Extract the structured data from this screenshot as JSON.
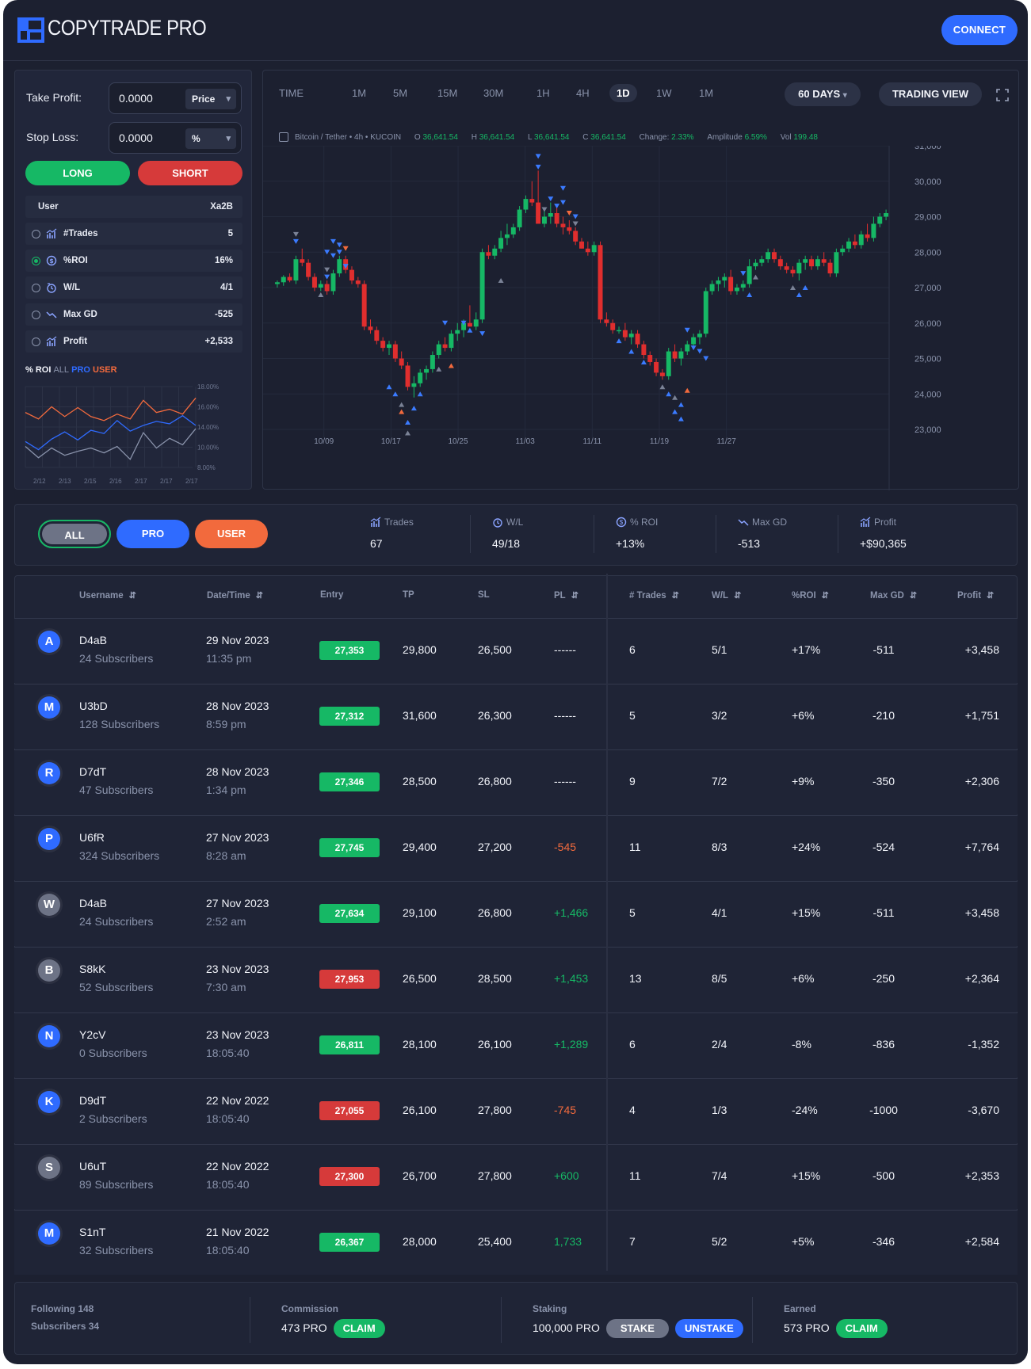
{
  "header": {
    "brand": "COPYTRADE PRO",
    "connect": "CONNECT"
  },
  "order": {
    "tp_label": "Take Profit:",
    "tp_value": "0.0000",
    "tp_unit": "Price",
    "sl_label": "Stop Loss:",
    "sl_value": "0.0000",
    "sl_unit": "%",
    "long": "LONG",
    "short": "SHORT"
  },
  "user_panel": {
    "head_left": "User",
    "head_right": "Xa2B",
    "rows": [
      {
        "name": "#Trades",
        "value": "5",
        "selected": false
      },
      {
        "name": "%ROI",
        "value": "16%",
        "selected": true
      },
      {
        "name": "W/L",
        "value": "4/1",
        "selected": false
      },
      {
        "name": "Max GD",
        "value": "-525",
        "selected": false
      },
      {
        "name": "Profit",
        "value": "+2,533",
        "selected": false
      }
    ]
  },
  "roi_chart": {
    "title_a": "% ROI",
    "title_b": "ALL",
    "title_c": "PRO",
    "title_d": "USER",
    "yticks": [
      "18.00%",
      "16.00%",
      "14.00%",
      "10.00%",
      "8.00%"
    ],
    "xticks": [
      "2/12",
      "2/13",
      "2/15",
      "2/16",
      "2/17",
      "2/17",
      "2/17"
    ]
  },
  "timeframes": [
    "TIME",
    "1M",
    "5M",
    "15M",
    "30M",
    "1H",
    "4H",
    "1D",
    "1W",
    "1M"
  ],
  "timeframe_active": "1D",
  "range": "60 DAYS",
  "trading_view": "TRADING VIEW",
  "legend": {
    "pair": "Bitcoin / Tether • 4h • KUCOIN",
    "o": "O",
    "o_val": "36,641.54",
    "h": "H",
    "h_val": "36,641.54",
    "l": "L",
    "l_val": "36,641.54",
    "c": "C",
    "c_val": "36,641.54",
    "change": "Change:",
    "change_val": "2.33%",
    "amp": "Amplitude",
    "amp_val": "6.59%",
    "vol": "Vol",
    "vol_val": "199.48"
  },
  "chart_data": {
    "type": "candlestick",
    "y_ticks": [
      "31,000",
      "30,000",
      "29,000",
      "28,000",
      "27,000",
      "26,000",
      "25,000",
      "24,000",
      "23,000"
    ],
    "x_ticks": [
      "10/09",
      "10/17",
      "10/25",
      "11/03",
      "11/11",
      "11/19",
      "11/27"
    ],
    "ylim": [
      23000,
      31000
    ],
    "candles": [
      [
        27100,
        27200,
        27000,
        27150
      ],
      [
        27150,
        27350,
        27050,
        27300
      ],
      [
        27300,
        27400,
        27150,
        27200
      ],
      [
        27200,
        27900,
        27100,
        27800
      ],
      [
        27800,
        28100,
        27600,
        27700
      ],
      [
        27700,
        27800,
        27200,
        27300
      ],
      [
        27300,
        27400,
        26900,
        27000
      ],
      [
        27000,
        27200,
        26900,
        27100
      ],
      [
        27100,
        27200,
        26800,
        26900
      ],
      [
        26900,
        27500,
        26800,
        27400
      ],
      [
        27400,
        27900,
        27300,
        27800
      ],
      [
        27800,
        27900,
        27400,
        27500
      ],
      [
        27500,
        27600,
        27100,
        27200
      ],
      [
        27200,
        27300,
        27000,
        27100
      ],
      [
        27100,
        27200,
        25800,
        25900
      ],
      [
        25900,
        26100,
        25700,
        25800
      ],
      [
        25800,
        25900,
        25400,
        25500
      ],
      [
        25500,
        25600,
        25200,
        25300
      ],
      [
        25300,
        25500,
        25100,
        25400
      ],
      [
        25400,
        25500,
        24900,
        25000
      ],
      [
        25000,
        25200,
        24700,
        24800
      ],
      [
        24800,
        24900,
        24100,
        24200
      ],
      [
        24200,
        24500,
        23900,
        24300
      ],
      [
        24300,
        24700,
        24200,
        24600
      ],
      [
        24600,
        24800,
        24400,
        24700
      ],
      [
        24700,
        25200,
        24600,
        25100
      ],
      [
        25100,
        25500,
        25000,
        25400
      ],
      [
        25400,
        25600,
        25200,
        25300
      ],
      [
        25300,
        25800,
        25200,
        25700
      ],
      [
        25700,
        26000,
        25500,
        25800
      ],
      [
        25800,
        26100,
        25600,
        26000
      ],
      [
        26000,
        26500,
        25900,
        25900
      ],
      [
        25900,
        26300,
        25800,
        26100
      ],
      [
        26100,
        28100,
        26000,
        28000
      ],
      [
        28000,
        28200,
        27800,
        27900
      ],
      [
        27900,
        28200,
        27800,
        28100
      ],
      [
        28100,
        28600,
        28000,
        28400
      ],
      [
        28400,
        28800,
        28200,
        28500
      ],
      [
        28500,
        28800,
        28400,
        28700
      ],
      [
        28700,
        29300,
        28600,
        29200
      ],
      [
        29200,
        29600,
        29100,
        29500
      ],
      [
        29500,
        30000,
        29300,
        29400
      ],
      [
        29400,
        30300,
        28900,
        28800
      ],
      [
        28800,
        29200,
        28700,
        29000
      ],
      [
        29000,
        29400,
        28800,
        29100
      ],
      [
        29100,
        29300,
        28700,
        28800
      ],
      [
        28800,
        29000,
        28500,
        28700
      ],
      [
        28700,
        28900,
        28500,
        28600
      ],
      [
        28600,
        28700,
        28200,
        28300
      ],
      [
        28300,
        28400,
        28100,
        28100
      ],
      [
        28100,
        28300,
        27900,
        28000
      ],
      [
        28000,
        28300,
        27900,
        28200
      ],
      [
        28200,
        28300,
        26000,
        26100
      ],
      [
        26100,
        26300,
        25900,
        26000
      ],
      [
        26000,
        26100,
        25700,
        25800
      ],
      [
        25800,
        25900,
        25700,
        25800
      ],
      [
        25800,
        26000,
        25500,
        25600
      ],
      [
        25600,
        25800,
        25400,
        25700
      ],
      [
        25700,
        25800,
        25300,
        25400
      ],
      [
        25400,
        25500,
        25000,
        25100
      ],
      [
        25100,
        25200,
        24800,
        24900
      ],
      [
        24900,
        25000,
        24500,
        24600
      ],
      [
        24600,
        24700,
        24400,
        24500
      ],
      [
        24500,
        25300,
        24400,
        25200
      ],
      [
        25200,
        25400,
        24900,
        25000
      ],
      [
        25000,
        25300,
        24800,
        25200
      ],
      [
        25200,
        25500,
        25100,
        25400
      ],
      [
        25400,
        25700,
        25300,
        25600
      ],
      [
        25600,
        25800,
        25400,
        25700
      ],
      [
        25700,
        27000,
        25600,
        26900
      ],
      [
        26900,
        27200,
        26800,
        27100
      ],
      [
        27100,
        27300,
        26900,
        27200
      ],
      [
        27200,
        27400,
        27000,
        27300
      ],
      [
        27300,
        27500,
        26800,
        26900
      ],
      [
        26900,
        27100,
        26800,
        27000
      ],
      [
        27000,
        27200,
        26900,
        27100
      ],
      [
        27100,
        27800,
        27000,
        27600
      ],
      [
        27600,
        27800,
        27500,
        27700
      ],
      [
        27700,
        27900,
        27600,
        27800
      ],
      [
        27800,
        28100,
        27700,
        28000
      ],
      [
        28000,
        28100,
        27700,
        27800
      ],
      [
        27800,
        27900,
        27500,
        27600
      ],
      [
        27600,
        27700,
        27400,
        27500
      ],
      [
        27500,
        27600,
        27300,
        27400
      ],
      [
        27400,
        27800,
        27200,
        27700
      ],
      [
        27700,
        27900,
        27500,
        27800
      ],
      [
        27800,
        27900,
        27500,
        27600
      ],
      [
        27600,
        27900,
        27500,
        27800
      ],
      [
        27800,
        28000,
        27600,
        27700
      ],
      [
        27700,
        27800,
        27300,
        27400
      ],
      [
        27400,
        28100,
        27300,
        28000
      ],
      [
        28000,
        28200,
        27900,
        28100
      ],
      [
        28100,
        28400,
        28000,
        28300
      ],
      [
        28300,
        28500,
        28100,
        28200
      ],
      [
        28200,
        28600,
        28100,
        28500
      ],
      [
        28500,
        28800,
        28300,
        28400
      ],
      [
        28400,
        29000,
        28300,
        28800
      ],
      [
        28800,
        29100,
        28700,
        29000
      ],
      [
        29000,
        29200,
        28900,
        29100
      ]
    ]
  },
  "filters": {
    "all": "ALL",
    "pro": "PRO",
    "user": "USER"
  },
  "summary": [
    {
      "label": "Trades",
      "value": "67"
    },
    {
      "label": "W/L",
      "value": "49/18"
    },
    {
      "label": "% ROI",
      "value": "+13%"
    },
    {
      "label": "Max GD",
      "value": "-513"
    },
    {
      "label": "Profit",
      "value": "+$90,365"
    }
  ],
  "table": {
    "headers": [
      "Username",
      "Date/Time",
      "Entry",
      "TP",
      "SL",
      "PL",
      "# Trades",
      "W/L",
      "%ROI",
      "Max GD",
      "Profit"
    ],
    "rows": [
      {
        "initial": "A",
        "avatar": "#2f6bff",
        "user": "D4aB",
        "subs": "24 Subscribers",
        "date": "29 Nov 2023",
        "time": "11:35 pm",
        "entry": "27,353",
        "entry_color": "#16b865",
        "tp": "29,800",
        "sl": "26,500",
        "pl": "------",
        "pl_color": "#f2f4fa",
        "trades": "6",
        "wl": "5/1",
        "roi": "+17%",
        "gd": "-511",
        "profit": "+3,458"
      },
      {
        "initial": "M",
        "avatar": "#2f6bff",
        "user": "U3bD",
        "subs": "128 Subscribers",
        "date": "28 Nov 2023",
        "time": "8:59 pm",
        "entry": "27,312",
        "entry_color": "#16b865",
        "tp": "31,600",
        "sl": "26,300",
        "pl": "------",
        "pl_color": "#f2f4fa",
        "trades": "5",
        "wl": "3/2",
        "roi": "+6%",
        "gd": "-210",
        "profit": "+1,751"
      },
      {
        "initial": "R",
        "avatar": "#2f6bff",
        "user": "D7dT",
        "subs": "47 Subscribers",
        "date": "28 Nov 2023",
        "time": "1:34 pm",
        "entry": "27,346",
        "entry_color": "#16b865",
        "tp": "28,500",
        "sl": "26,800",
        "pl": "------",
        "pl_color": "#f2f4fa",
        "trades": "9",
        "wl": "7/2",
        "roi": "+9%",
        "gd": "-350",
        "profit": "+2,306"
      },
      {
        "initial": "P",
        "avatar": "#2f6bff",
        "user": "U6fR",
        "subs": "324 Subscribers",
        "date": "27 Nov 2023",
        "time": "8:28 am",
        "entry": "27,745",
        "entry_color": "#16b865",
        "tp": "29,400",
        "sl": "27,200",
        "pl": "-545",
        "pl_color": "#f26a3d",
        "trades": "11",
        "wl": "8/3",
        "roi": "+24%",
        "gd": "-524",
        "profit": "+7,764"
      },
      {
        "initial": "W",
        "avatar": "#6d7386",
        "user": "D4aB",
        "subs": "24 Subscribers",
        "date": "27 Nov 2023",
        "time": "2:52 am",
        "entry": "27,634",
        "entry_color": "#16b865",
        "tp": "29,100",
        "sl": "26,800",
        "pl": "+1,466",
        "pl_color": "#16b865",
        "trades": "5",
        "wl": "4/1",
        "roi": "+15%",
        "gd": "-511",
        "profit": "+3,458"
      },
      {
        "initial": "B",
        "avatar": "#6d7386",
        "user": "S8kK",
        "subs": "52 Subscribers",
        "date": "23 Nov 2023",
        "time": "7:30 am",
        "entry": "27,953",
        "entry_color": "#d63a3a",
        "tp": "26,500",
        "sl": "28,500",
        "pl": "+1,453",
        "pl_color": "#16b865",
        "trades": "13",
        "wl": "8/5",
        "roi": "+6%",
        "gd": "-250",
        "profit": "+2,364"
      },
      {
        "initial": "N",
        "avatar": "#2f6bff",
        "user": "Y2cV",
        "subs": "0 Subscribers",
        "date": "23 Nov 2023",
        "time": "18:05:40",
        "entry": "26,811",
        "entry_color": "#16b865",
        "tp": "28,100",
        "sl": "26,100",
        "pl": "+1,289",
        "pl_color": "#16b865",
        "trades": "6",
        "wl": "2/4",
        "roi": "-8%",
        "gd": "-836",
        "profit": "-1,352"
      },
      {
        "initial": "K",
        "avatar": "#2f6bff",
        "user": "D9dT",
        "subs": "2 Subscribers",
        "date": "22 Nov 2022",
        "time": "18:05:40",
        "entry": "27,055",
        "entry_color": "#d63a3a",
        "tp": "26,100",
        "sl": "27,800",
        "pl": "-745",
        "pl_color": "#f26a3d",
        "trades": "4",
        "wl": "1/3",
        "roi": "-24%",
        "gd": "-1000",
        "profit": "-3,670"
      },
      {
        "initial": "S",
        "avatar": "#6d7386",
        "user": "U6uT",
        "subs": "89 Subscribers",
        "date": "22 Nov 2022",
        "time": "18:05:40",
        "entry": "27,300",
        "entry_color": "#d63a3a",
        "tp": "26,700",
        "sl": "27,800",
        "pl": "+600",
        "pl_color": "#16b865",
        "trades": "11",
        "wl": "7/4",
        "roi": "+15%",
        "gd": "-500",
        "profit": "+2,353"
      },
      {
        "initial": "M",
        "avatar": "#2f6bff",
        "user": "S1nT",
        "subs": "32 Subscribers",
        "date": "21 Nov 2022",
        "time": "18:05:40",
        "entry": "26,367",
        "entry_color": "#16b865",
        "tp": "28,000",
        "sl": "25,400",
        "pl": "1,733",
        "pl_color": "#16b865",
        "trades": "7",
        "wl": "5/2",
        "roi": "+5%",
        "gd": "-346",
        "profit": "+2,584"
      }
    ]
  },
  "footer": {
    "following": "Following 148",
    "subscribers": "Subscribers 34",
    "commission_label": "Commission",
    "commission_value": "473 PRO",
    "claim": "CLAIM",
    "staking_label": "Staking",
    "staking_value": "100,000 PRO",
    "stake": "STAKE",
    "unstake": "UNSTAKE",
    "earned_label": "Earned",
    "earned_value": "573 PRO",
    "claim2": "CLAIM"
  }
}
